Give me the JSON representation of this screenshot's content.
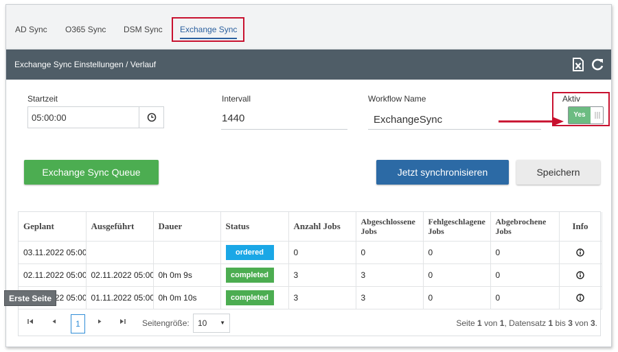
{
  "tabs": [
    {
      "label": "AD Sync"
    },
    {
      "label": "O365 Sync"
    },
    {
      "label": "DSM Sync"
    },
    {
      "label": "Exchange Sync"
    }
  ],
  "panel": {
    "title": "Exchange Sync Einstellungen / Verlauf"
  },
  "header_icons": [
    "excel-export-icon",
    "refresh-icon"
  ],
  "form": {
    "startzeit_label": "Startzeit",
    "startzeit_value": "05:00:00",
    "intervall_label": "Intervall",
    "intervall_value": "1440",
    "workflow_label": "Workflow Name",
    "workflow_value": "ExchangeSync",
    "aktiv_label": "Aktiv",
    "aktiv_toggle": "Yes"
  },
  "buttons": {
    "queue": "Exchange Sync Queue",
    "sync_now": "Jetzt synchronisieren",
    "save": "Speichern"
  },
  "table": {
    "columns": [
      "Geplant",
      "Ausgeführt",
      "Dauer",
      "Status",
      "Anzahl Jobs",
      "Abgeschlossene Jobs",
      "Fehlgeschlagene Jobs",
      "Abgebrochene Jobs",
      "Info"
    ],
    "rows": [
      {
        "geplant": "03.11.2022 05:00:",
        "ausgefuehrt": "",
        "dauer": "",
        "status": "ordered",
        "anzahl": "0",
        "abgeschlossen": "0",
        "fehlgeschlagen": "0",
        "abgebrochen": "0"
      },
      {
        "geplant": "02.11.2022 05:00:",
        "ausgefuehrt": "02.11.2022 05:00:",
        "dauer": "0h 0m 9s",
        "status": "completed",
        "anzahl": "3",
        "abgeschlossen": "3",
        "fehlgeschlagen": "0",
        "abgebrochen": "0"
      },
      {
        "geplant": "01.11.2022 05:00:",
        "ausgefuehrt": "01.11.2022 05:00:",
        "dauer": "0h 0m 10s",
        "status": "completed",
        "anzahl": "3",
        "abgeschlossen": "3",
        "fehlgeschlagen": "0",
        "abgebrochen": "0"
      }
    ]
  },
  "pager": {
    "current_page": "1",
    "page_size_label": "Seitengröße:",
    "page_size": "10",
    "info_seite": "Seite",
    "info_page": "1",
    "info_von": "von",
    "info_pages": "1",
    "info_datensatz": ", Datensatz",
    "info_from": "1",
    "info_bis": "bis",
    "info_to": "3",
    "info_von2": "von",
    "info_total": "3",
    "info_end": "."
  },
  "tooltip": "Erste Seite",
  "colors": {
    "header_bg": "#4f5d67",
    "accent_blue": "#2c6aa5",
    "green": "#4cad51",
    "ordered_blue": "#1aa7e6",
    "highlight_red": "#c8102e"
  }
}
